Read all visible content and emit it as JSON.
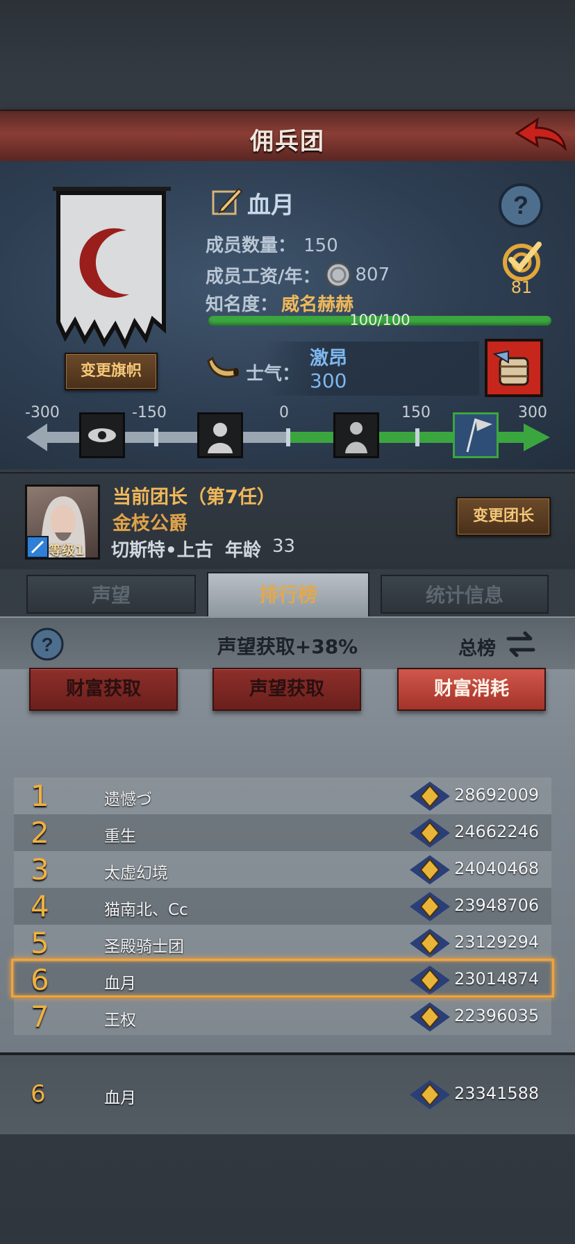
{
  "header": {
    "title": "佣兵团"
  },
  "guild": {
    "name": "血月",
    "members_label": "成员数量：",
    "members_value": "150",
    "salary_label": "成员工资/年：",
    "salary_value": "807",
    "fame_label": "知名度：",
    "fame_value": "威名赫赫",
    "fame_progress_text": "100/100",
    "fame_progress": 1.0,
    "rank_badge_value": "81",
    "change_flag_label": "变更旗帜"
  },
  "morale": {
    "label": "士气：",
    "status": "激昂",
    "value": "300",
    "scale_ticks": [
      "-300",
      "-150",
      "0",
      "150",
      "300"
    ],
    "stages": [
      "eye-icon",
      "despair-icon",
      "calm-icon",
      "banner-charge-icon"
    ],
    "active_stage": 3
  },
  "leader": {
    "title": "当前团长（第7任）",
    "rank_title": "金枝公爵",
    "name": "切斯特•上古",
    "age_label": "年龄",
    "age_value": "33",
    "level_label": "等级1",
    "change_button": "变更团长"
  },
  "tabs": [
    {
      "label": "声望",
      "active": false
    },
    {
      "label": "排行榜",
      "active": true
    },
    {
      "label": "统计信息",
      "active": false
    }
  ],
  "ranking": {
    "bonus_text": "声望获取+38%",
    "scope_label": "总榜",
    "categories": [
      {
        "label": "财富获取",
        "active": false
      },
      {
        "label": "声望获取",
        "active": false
      },
      {
        "label": "财富消耗",
        "active": true
      }
    ],
    "rows": [
      {
        "rank": "1",
        "name": "遗憾づ",
        "score": "28692009"
      },
      {
        "rank": "2",
        "name": "重生",
        "score": "24662246"
      },
      {
        "rank": "3",
        "name": "太虚幻境",
        "score": "24040468"
      },
      {
        "rank": "4",
        "name": "猫南北、Cc",
        "score": "23948706"
      },
      {
        "rank": "5",
        "name": "圣殿骑士团",
        "score": "23129294"
      },
      {
        "rank": "6",
        "name": "血月",
        "score": "23014874"
      },
      {
        "rank": "7",
        "name": "王权",
        "score": "22396035"
      }
    ],
    "highlighted_rank": "6",
    "self": {
      "rank": "6",
      "name": "血月",
      "score": "23341588"
    }
  },
  "colors": {
    "accent_gold": "#f0b040",
    "header_red": "#8a3d35",
    "morale_green": "#3ba63f",
    "active_red": "#d0574b"
  }
}
